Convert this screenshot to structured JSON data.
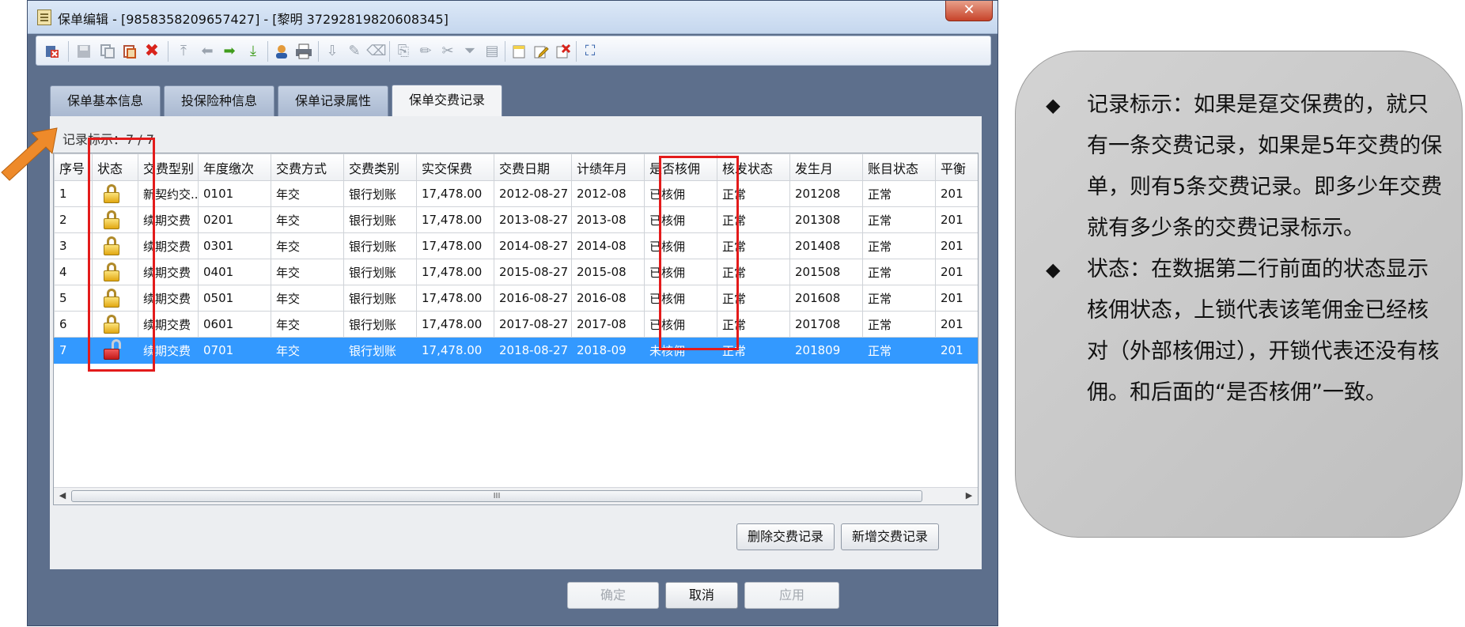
{
  "window": {
    "title": "保单编辑 - [9858358209657427] - [黎明 37292819820608345]",
    "close_label": "✕"
  },
  "toolbar": {
    "icons": [
      "exit-icon",
      "save-icon",
      "copy-icon",
      "paste-icon",
      "delete-icon",
      "first-icon",
      "prev-icon",
      "next-icon",
      "last-icon",
      "user-icon",
      "print-icon",
      "import-icon",
      "edit-icon",
      "clear-icon",
      "brush-icon",
      "pencil-icon",
      "cut-icon",
      "filter-icon",
      "layout-icon",
      "new-icon",
      "note-edit-icon",
      "remove-icon",
      "fullscreen-icon"
    ]
  },
  "tabs": [
    {
      "label": "保单基本信息",
      "active": false
    },
    {
      "label": "投保险种信息",
      "active": false
    },
    {
      "label": "保单记录属性",
      "active": false
    },
    {
      "label": "保单交费记录",
      "active": true
    }
  ],
  "record": {
    "label": "记录标示：7 / 7"
  },
  "grid": {
    "columns": [
      "序号",
      "状态",
      "交费型别",
      "年度缴次",
      "交费方式",
      "交费类别",
      "实交保费",
      "交费日期",
      "计绩年月",
      "是否核佣",
      "核发状态",
      "发生月",
      "账目状态",
      "平衡"
    ],
    "rows": [
      {
        "no": "1",
        "status": "locked",
        "type": "新契约交...",
        "seq": "0101",
        "method": "年交",
        "category": "银行划账",
        "premium": "17,478.00",
        "date": "2012-08-27",
        "month": "2012-08",
        "checked": "已核佣",
        "issue": "正常",
        "occur": "201208",
        "account": "正常",
        "balance": "201"
      },
      {
        "no": "2",
        "status": "locked",
        "type": "续期交费",
        "seq": "0201",
        "method": "年交",
        "category": "银行划账",
        "premium": "17,478.00",
        "date": "2013-08-27",
        "month": "2013-08",
        "checked": "已核佣",
        "issue": "正常",
        "occur": "201308",
        "account": "正常",
        "balance": "201"
      },
      {
        "no": "3",
        "status": "locked",
        "type": "续期交费",
        "seq": "0301",
        "method": "年交",
        "category": "银行划账",
        "premium": "17,478.00",
        "date": "2014-08-27",
        "month": "2014-08",
        "checked": "已核佣",
        "issue": "正常",
        "occur": "201408",
        "account": "正常",
        "balance": "201"
      },
      {
        "no": "4",
        "status": "locked",
        "type": "续期交费",
        "seq": "0401",
        "method": "年交",
        "category": "银行划账",
        "premium": "17,478.00",
        "date": "2015-08-27",
        "month": "2015-08",
        "checked": "已核佣",
        "issue": "正常",
        "occur": "201508",
        "account": "正常",
        "balance": "201"
      },
      {
        "no": "5",
        "status": "locked",
        "type": "续期交费",
        "seq": "0501",
        "method": "年交",
        "category": "银行划账",
        "premium": "17,478.00",
        "date": "2016-08-27",
        "month": "2016-08",
        "checked": "已核佣",
        "issue": "正常",
        "occur": "201608",
        "account": "正常",
        "balance": "201"
      },
      {
        "no": "6",
        "status": "locked",
        "type": "续期交费",
        "seq": "0601",
        "method": "年交",
        "category": "银行划账",
        "premium": "17,478.00",
        "date": "2017-08-27",
        "month": "2017-08",
        "checked": "已核佣",
        "issue": "正常",
        "occur": "201708",
        "account": "正常",
        "balance": "201"
      },
      {
        "no": "7",
        "status": "unlocked",
        "type": "续期交费",
        "seq": "0701",
        "method": "年交",
        "category": "银行划账",
        "premium": "17,478.00",
        "date": "2018-08-27",
        "month": "2018-09",
        "checked": "未核佣",
        "issue": "正常",
        "occur": "201809",
        "account": "正常",
        "balance": "201"
      }
    ],
    "scroll_grip": "III"
  },
  "panel_buttons": {
    "delete": "删除交费记录",
    "add": "新增交费记录"
  },
  "dialog_buttons": {
    "ok": "确定",
    "cancel": "取消",
    "apply": "应用"
  },
  "notes": [
    "记录标示：如果是趸交保费的，就只有一条交费记录，如果是5年交费的保单，则有5条交费记录。即多少年交费就有多少条的交费记录标示。",
    "状态：在数据第二行前面的状态显示核佣状态，上锁代表该笔佣金已经核对（外部核佣过），开锁代表还没有核佣。和后面的“是否核佣”一致。"
  ],
  "colors": {
    "highlight": "#e31b1b",
    "selection": "#3399ff",
    "arrow": "#ee8a2a"
  }
}
